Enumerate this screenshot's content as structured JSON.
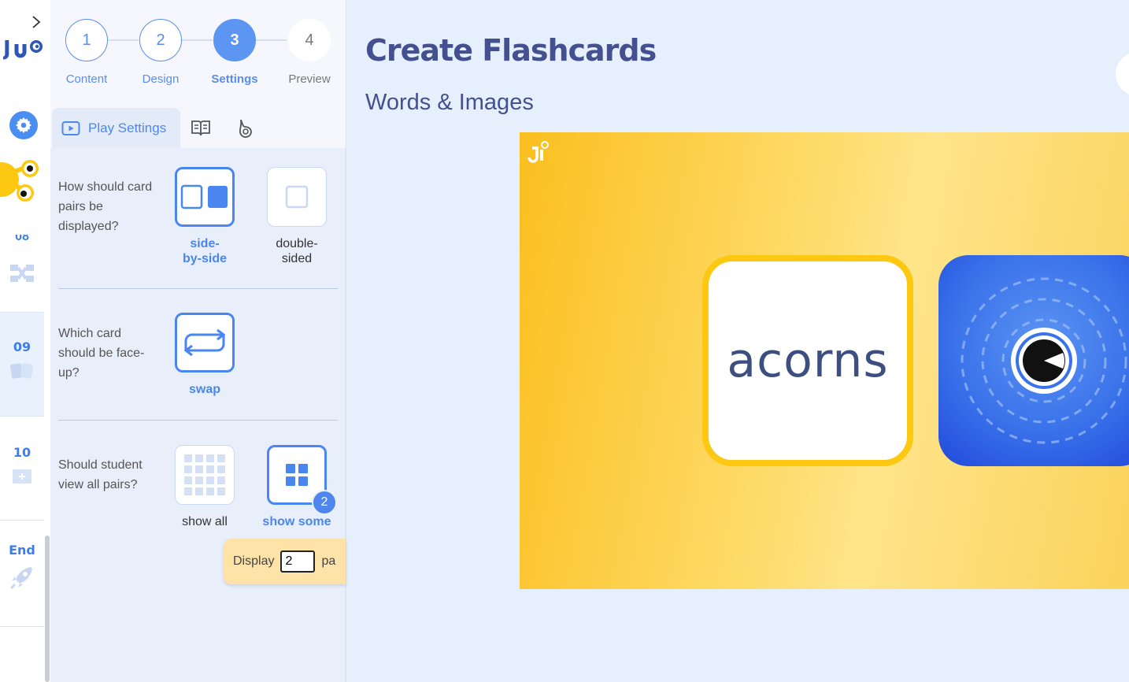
{
  "rail": {
    "sections": [
      {
        "num": "09"
      },
      {
        "num": "10"
      },
      {
        "num": "End"
      }
    ]
  },
  "stepper": {
    "steps": [
      {
        "num": "1",
        "label": "Content"
      },
      {
        "num": "2",
        "label": "Design"
      },
      {
        "num": "3",
        "label": "Settings"
      },
      {
        "num": "4",
        "label": "Preview"
      }
    ]
  },
  "tabs": {
    "active_label": "Play Settings"
  },
  "settings": {
    "q1": {
      "label": "How should card pairs be displayed?",
      "options": [
        {
          "label": "side-by-side",
          "selected": true
        },
        {
          "label": "double-sided",
          "selected": false
        }
      ]
    },
    "q2": {
      "label": "Which card should be face-up?",
      "options": [
        {
          "label": "swap",
          "selected": true
        }
      ]
    },
    "q3": {
      "label": "Should student view all pairs?",
      "options": [
        {
          "label": "show all",
          "selected": false
        },
        {
          "label": "show some",
          "selected": true,
          "badge": "2"
        }
      ]
    },
    "display": {
      "prefix": "Display",
      "value": "2",
      "suffix": "pa"
    }
  },
  "main": {
    "title": "Create Flashcards",
    "subtitle": "Words & Images",
    "card_word": "acorns"
  },
  "colors": {
    "accent": "#4a86ef",
    "title": "#44508f",
    "card_border": "#fcc812"
  }
}
